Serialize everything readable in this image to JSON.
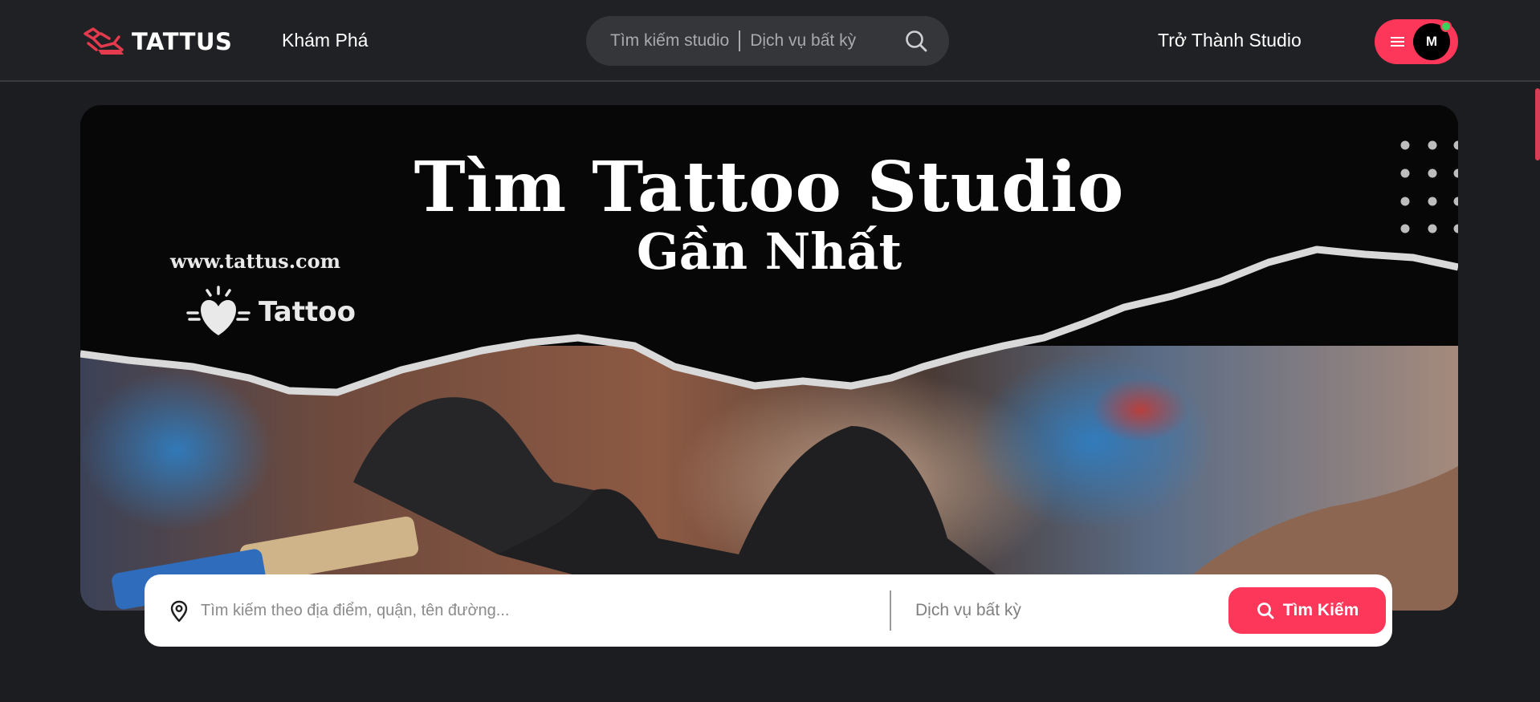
{
  "header": {
    "logo_text": "TATTUS",
    "nav_explore": "Khám Phá",
    "search": {
      "studio_placeholder": "Tìm kiếm studio",
      "service_placeholder": "Dịch vụ bất kỳ"
    },
    "become_studio": "Trở Thành Studio",
    "user": {
      "avatar_initial": "M",
      "online": true
    }
  },
  "banner": {
    "title": "Tìm Tattoo Studio",
    "subtitle": "Gần Nhất",
    "url_text": "www.tattus.com",
    "brand_label": "Tattoo"
  },
  "main_search": {
    "location_placeholder": "Tìm kiếm theo địa điểm, quận, tên đường...",
    "service_placeholder": "Dịch vụ bất kỳ",
    "submit_label": "Tìm Kiếm"
  },
  "colors": {
    "accent": "#fd3759",
    "header_bg": "#202124",
    "page_bg": "#1c1d20",
    "online": "#3bd35a"
  },
  "icons": [
    "tattoo-machine-logo-icon",
    "search-icon",
    "menu-icon",
    "location-pin-icon",
    "heart-logo-icon"
  ]
}
